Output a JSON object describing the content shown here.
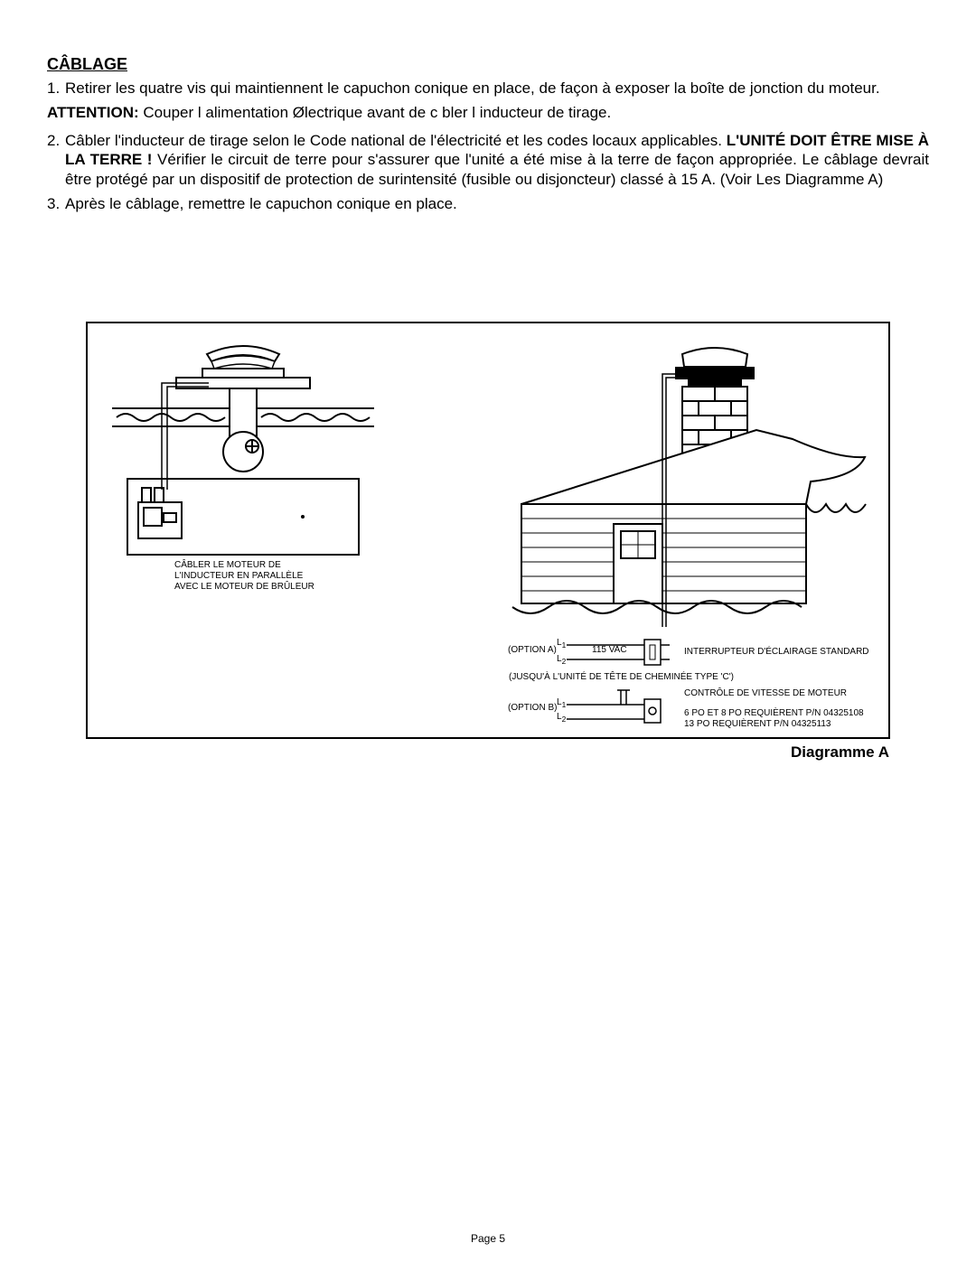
{
  "heading": "CÂBLAGE",
  "item1_num": "1.",
  "item1_text": "Retirer les quatre vis qui maintiennent le capuchon conique en place, de façon à exposer la boîte de jonction du moteur.",
  "attention_label": "ATTENTION:",
  "attention_text": " Couper l alimentation Ølectrique avant de c bler l inducteur de tirage.",
  "item2_num": "2.",
  "item2_pre": "Câbler l'inducteur de tirage selon le Code national de l'électricité et les codes locaux applicables. ",
  "item2_bold": "L'UNITÉ DOIT ÊTRE MISE À LA TERRE !",
  "item2_post": " Vérifier le circuit de terre pour s'assurer que l'unité a été mise à la terre de façon appropriée. Le câblage devrait être protégé par un dispositif de protection de surintensité (fusible ou disjoncteur) classé à 15 A. (Voir Les Diagramme A)",
  "item3_num": "3.",
  "item3_text": "Après le câblage, remettre le capuchon conique en place.",
  "left_caption_l1": "CÂBLER LE MOTEUR DE",
  "left_caption_l2": "L'INDUCTEUR EN PARALLÈLE",
  "left_caption_l3": "AVEC LE MOTEUR DE BRÛLEUR",
  "wiring": {
    "l1": "L",
    "sub1": "1",
    "l2": "L",
    "sub2": "2",
    "option_a": "(OPTION A)",
    "voltage": "115 VAC",
    "switch_label": "INTERRUPTEUR D'ÉCLAIRAGE STANDARD",
    "chimney_note": "(JUSQU'À L'UNITÉ DE TÊTE DE CHEMINÉE TYPE 'C')",
    "option_b": "(OPTION B)",
    "speed_label": "CONTRÔLE DE VITESSE DE MOTEUR",
    "pn_line1": "6 PO ET 8 PO REQUIÈRENT P/N 04325108",
    "pn_line2": "13 PO REQUIÈRENT P/N 04325113"
  },
  "diagram_caption": "Diagramme A",
  "page_number": "Page 5"
}
